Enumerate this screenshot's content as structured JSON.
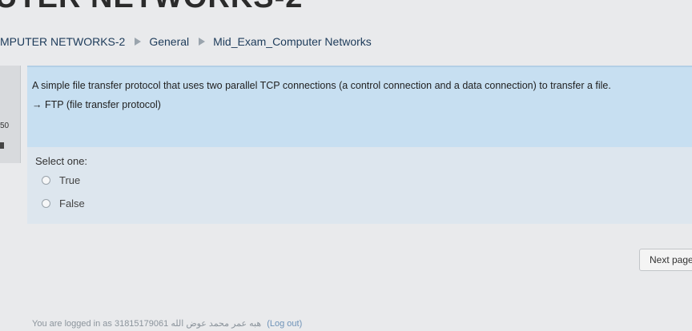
{
  "page": {
    "heading": "UTER NETWORKS-2"
  },
  "breadcrumb": {
    "items": [
      {
        "label": "MPUTER NETWORKS-2"
      },
      {
        "label": "General"
      },
      {
        "label": "Mid_Exam_Computer Networks"
      }
    ]
  },
  "question_info": {
    "number": "50"
  },
  "question": {
    "text": "A simple file transfer protocol that uses two parallel TCP connections (a control connection and a data connection) to transfer a file.",
    "answer_line": "→ FTP (file transfer protocol)",
    "prompt": "Select one:",
    "options": [
      {
        "label": "True",
        "selected": false
      },
      {
        "label": "False",
        "selected": false
      }
    ]
  },
  "navigation": {
    "next_label": "Next page"
  },
  "footer": {
    "login_text": "You are logged in as 31815179061",
    "user_name": "هبه عمر محمد عوض الله",
    "logout_label": "(Log out)"
  },
  "colors": {
    "question_bg": "#c7dff1",
    "answer_bg": "#dde6ee",
    "link": "#1d3b5a"
  }
}
